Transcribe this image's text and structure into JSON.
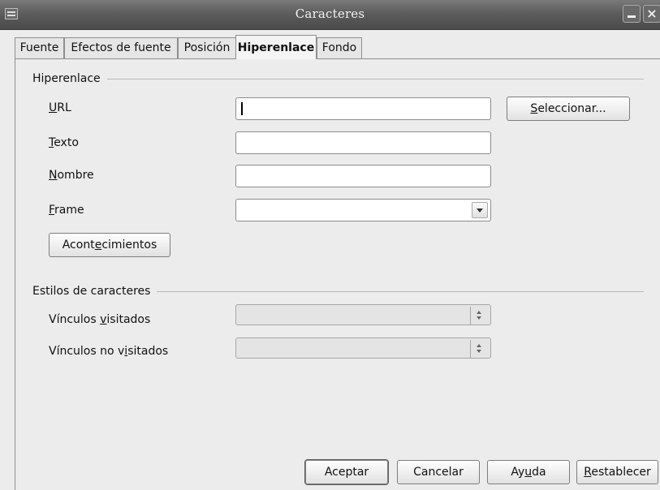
{
  "window": {
    "title": "Caracteres"
  },
  "tabs": [
    {
      "label": "Fuente"
    },
    {
      "label": "Efectos de fuente"
    },
    {
      "label": "Posición"
    },
    {
      "label": "Hiperenlace",
      "active": true
    },
    {
      "label": "Fondo"
    }
  ],
  "hyperlink": {
    "section": "Hiperenlace",
    "url": {
      "label_pre": "",
      "label_ul": "U",
      "label_post": "RL",
      "value": ""
    },
    "text": {
      "label_pre": "",
      "label_ul": "T",
      "label_post": "exto",
      "value": ""
    },
    "name": {
      "label_pre": "",
      "label_ul": "N",
      "label_post": "ombre",
      "value": ""
    },
    "frame": {
      "label_pre": "",
      "label_ul": "F",
      "label_post": "rame",
      "value": ""
    },
    "select_button": {
      "pre": "",
      "ul": "S",
      "post": "eleccionar..."
    },
    "events_button": {
      "pre": "Acont",
      "ul": "e",
      "post": "cimientos"
    }
  },
  "char_styles": {
    "section": "Estilos de caracteres",
    "visited": {
      "label_pre": "Vínculos ",
      "label_ul": "v",
      "label_post": "isitados",
      "value": ""
    },
    "unvisited": {
      "label_pre": "Vínculos no v",
      "label_ul": "i",
      "label_post": "sitados",
      "value": ""
    }
  },
  "buttons": {
    "ok": {
      "pre": "Aceptar",
      "ul": "",
      "post": ""
    },
    "cancel": {
      "pre": "Cancelar",
      "ul": "",
      "post": ""
    },
    "help": {
      "pre": "Ay",
      "ul": "u",
      "post": "da"
    },
    "reset": {
      "pre": "",
      "ul": "R",
      "post": "establecer"
    }
  }
}
